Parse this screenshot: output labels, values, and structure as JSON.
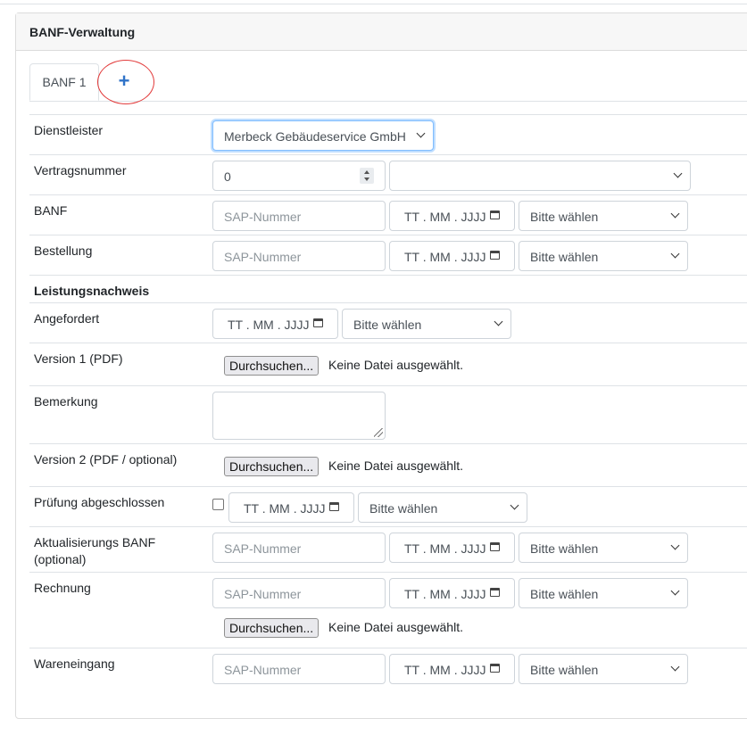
{
  "card": {
    "title": "BANF-Verwaltung"
  },
  "tabs": [
    {
      "label": "BANF 1"
    },
    {
      "label": "+"
    }
  ],
  "rows": {
    "dienstleister": {
      "label": "Dienstleister",
      "select_value": "Merbeck Gebäudeservice GmbH"
    },
    "vertragsnummer": {
      "label": "Vertragsnummer",
      "number_value": "0",
      "select_value": ""
    },
    "banf": {
      "label": "BANF",
      "sap_placeholder": "SAP-Nummer",
      "date_placeholder": "TT . MM . JJJJ",
      "select_value": "Bitte wählen"
    },
    "bestellung": {
      "label": "Bestellung",
      "sap_placeholder": "SAP-Nummer",
      "date_placeholder": "TT . MM . JJJJ",
      "select_value": "Bitte wählen"
    },
    "leistungsnachweis": {
      "label": "Leistungsnachweis"
    },
    "angefordert": {
      "label": "Angefordert",
      "date_placeholder": "TT . MM . JJJJ",
      "select_value": "Bitte wählen"
    },
    "version1": {
      "label": "Version 1 (PDF)",
      "button": "Durchsuchen...",
      "file_status": "Keine Datei ausgewählt."
    },
    "bemerkung": {
      "label": "Bemerkung",
      "value": ""
    },
    "version2": {
      "label": "Version 2 (PDF / optional)",
      "button": "Durchsuchen...",
      "file_status": "Keine Datei ausgewählt."
    },
    "pruefung": {
      "label": "Prüfung abgeschlossen",
      "checked": false,
      "date_placeholder": "TT . MM . JJJJ",
      "select_value": "Bitte wählen"
    },
    "aktualisierung": {
      "label_line1": "Aktualisierungs BANF",
      "label_line2": "(optional)",
      "sap_placeholder": "SAP-Nummer",
      "date_placeholder": "TT . MM . JJJJ",
      "select_value": "Bitte wählen"
    },
    "rechnung": {
      "label": "Rechnung",
      "sap_placeholder": "SAP-Nummer",
      "date_placeholder": "TT . MM . JJJJ",
      "select_value": "Bitte wählen",
      "button": "Durchsuchen...",
      "file_status": "Keine Datei ausgewählt."
    },
    "wareneingang": {
      "label": "Wareneingang",
      "sap_placeholder": "SAP-Nummer",
      "date_placeholder": "TT . MM . JJJJ",
      "select_value": "Bitte wählen"
    }
  },
  "colors": {
    "accent": "#2f73c8",
    "highlight_circle": "#e23b3b",
    "focus_border": "#80bdff"
  },
  "icons": {
    "date": "calendar-icon",
    "select": "chevron-down-icon",
    "number": "spinner-icon",
    "add": "plus-icon"
  }
}
